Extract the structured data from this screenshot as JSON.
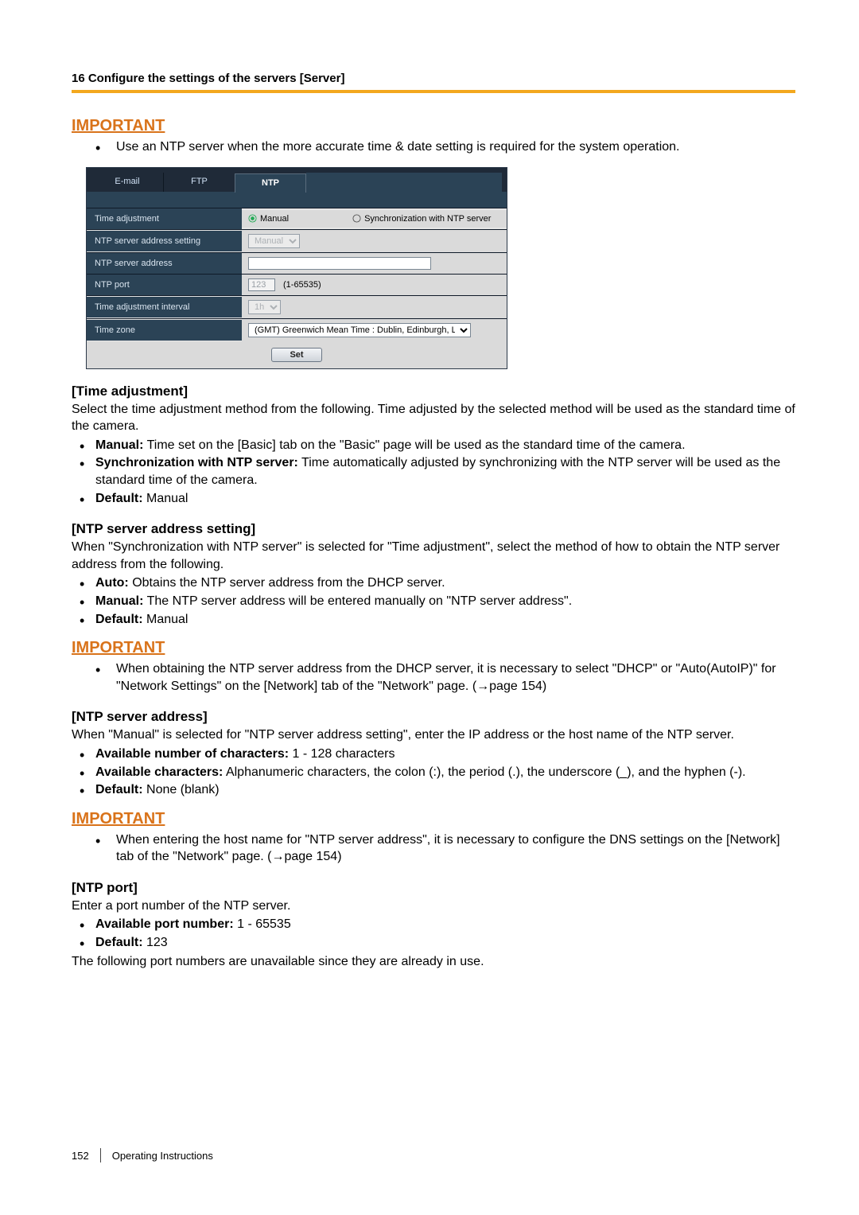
{
  "header": {
    "title": "16 Configure the settings of the servers [Server]"
  },
  "important1": {
    "title": "IMPORTANT",
    "bullet": "Use an NTP server when the more accurate time & date setting is required for the system operation."
  },
  "panel": {
    "tabs": {
      "email": "E-mail",
      "ftp": "FTP",
      "ntp": "NTP"
    },
    "rows": {
      "time_adj": {
        "label": "Time adjustment",
        "opt_manual": "Manual",
        "opt_sync": "Synchronization with NTP server"
      },
      "addr_setting": {
        "label": "NTP server address setting",
        "value": "Manual"
      },
      "addr": {
        "label": "NTP server address",
        "value": ""
      },
      "port": {
        "label": "NTP port",
        "value": "123",
        "range": "(1-65535)"
      },
      "interval": {
        "label": "Time adjustment interval",
        "value": "1h"
      },
      "tz": {
        "label": "Time zone",
        "value": "(GMT) Greenwich Mean Time : Dublin, Edinburgh, Lisbon, London"
      }
    },
    "set": "Set"
  },
  "sec_time_adj": {
    "h": "[Time adjustment]",
    "p": "Select the time adjustment method from the following. Time adjusted by the selected method will be used as the standard time of the camera.",
    "b1a": "Manual:",
    "b1b": " Time set on the [Basic] tab on the \"Basic\" page will be used as the standard time of the camera.",
    "b2a": "Synchronization with NTP server:",
    "b2b": " Time automatically adjusted by synchronizing with the NTP server will be used as the standard time of the camera.",
    "b3a": "Default:",
    "b3b": " Manual"
  },
  "sec_addr_setting": {
    "h": "[NTP server address setting]",
    "p": "When \"Synchronization with NTP server\" is selected for \"Time adjustment\", select the method of how to obtain the NTP server address from the following.",
    "b1a": "Auto:",
    "b1b": " Obtains the NTP server address from the DHCP server.",
    "b2a": "Manual:",
    "b2b": " The NTP server address will be entered manually on \"NTP server address\".",
    "b3a": "Default:",
    "b3b": " Manual"
  },
  "important2": {
    "title": "IMPORTANT",
    "bullet": "When obtaining the NTP server address from the DHCP server, it is necessary to select \"DHCP\" or \"Auto(AutoIP)\" for \"Network Settings\" on the [Network] tab of the \"Network\" page. (→page 154)"
  },
  "sec_addr": {
    "h": "[NTP server address]",
    "p": "When \"Manual\" is selected for \"NTP server address setting\", enter the IP address or the host name of the NTP server.",
    "b1a": "Available number of characters:",
    "b1b": " 1 - 128 characters",
    "b2a": "Available characters:",
    "b2b": " Alphanumeric characters, the colon (:), the period (.), the underscore (_), and the hyphen (-).",
    "b3a": "Default:",
    "b3b": " None (blank)"
  },
  "important3": {
    "title": "IMPORTANT",
    "bullet": "When entering the host name for \"NTP server address\", it is necessary to configure the DNS settings on the [Network] tab of the \"Network\" page. (→page 154)"
  },
  "sec_port": {
    "h": "[NTP port]",
    "p": "Enter a port number of the NTP server.",
    "b1a": "Available port number:",
    "b1b": " 1 - 65535",
    "b2a": "Default:",
    "b2b": " 123",
    "p2": "The following port numbers are unavailable since they are already in use."
  },
  "footer": {
    "page": "152",
    "label": "Operating Instructions"
  }
}
